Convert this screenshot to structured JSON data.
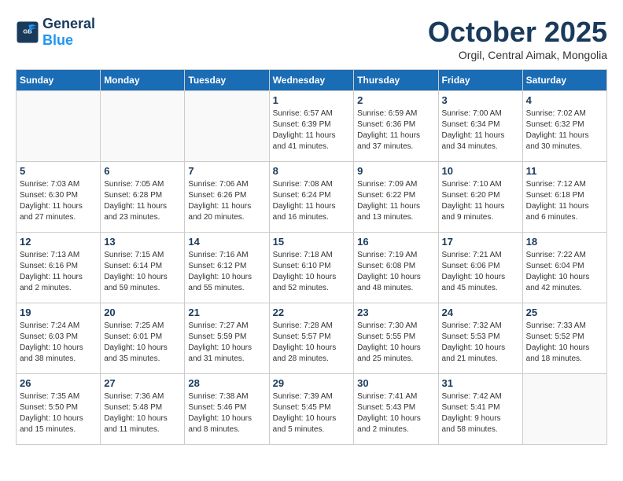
{
  "header": {
    "logo_general": "General",
    "logo_blue": "Blue",
    "month": "October 2025",
    "location": "Orgil, Central Aimak, Mongolia"
  },
  "days_of_week": [
    "Sunday",
    "Monday",
    "Tuesday",
    "Wednesday",
    "Thursday",
    "Friday",
    "Saturday"
  ],
  "weeks": [
    [
      {
        "day": "",
        "detail": ""
      },
      {
        "day": "",
        "detail": ""
      },
      {
        "day": "",
        "detail": ""
      },
      {
        "day": "1",
        "detail": "Sunrise: 6:57 AM\nSunset: 6:39 PM\nDaylight: 11 hours\nand 41 minutes."
      },
      {
        "day": "2",
        "detail": "Sunrise: 6:59 AM\nSunset: 6:36 PM\nDaylight: 11 hours\nand 37 minutes."
      },
      {
        "day": "3",
        "detail": "Sunrise: 7:00 AM\nSunset: 6:34 PM\nDaylight: 11 hours\nand 34 minutes."
      },
      {
        "day": "4",
        "detail": "Sunrise: 7:02 AM\nSunset: 6:32 PM\nDaylight: 11 hours\nand 30 minutes."
      }
    ],
    [
      {
        "day": "5",
        "detail": "Sunrise: 7:03 AM\nSunset: 6:30 PM\nDaylight: 11 hours\nand 27 minutes."
      },
      {
        "day": "6",
        "detail": "Sunrise: 7:05 AM\nSunset: 6:28 PM\nDaylight: 11 hours\nand 23 minutes."
      },
      {
        "day": "7",
        "detail": "Sunrise: 7:06 AM\nSunset: 6:26 PM\nDaylight: 11 hours\nand 20 minutes."
      },
      {
        "day": "8",
        "detail": "Sunrise: 7:08 AM\nSunset: 6:24 PM\nDaylight: 11 hours\nand 16 minutes."
      },
      {
        "day": "9",
        "detail": "Sunrise: 7:09 AM\nSunset: 6:22 PM\nDaylight: 11 hours\nand 13 minutes."
      },
      {
        "day": "10",
        "detail": "Sunrise: 7:10 AM\nSunset: 6:20 PM\nDaylight: 11 hours\nand 9 minutes."
      },
      {
        "day": "11",
        "detail": "Sunrise: 7:12 AM\nSunset: 6:18 PM\nDaylight: 11 hours\nand 6 minutes."
      }
    ],
    [
      {
        "day": "12",
        "detail": "Sunrise: 7:13 AM\nSunset: 6:16 PM\nDaylight: 11 hours\nand 2 minutes."
      },
      {
        "day": "13",
        "detail": "Sunrise: 7:15 AM\nSunset: 6:14 PM\nDaylight: 10 hours\nand 59 minutes."
      },
      {
        "day": "14",
        "detail": "Sunrise: 7:16 AM\nSunset: 6:12 PM\nDaylight: 10 hours\nand 55 minutes."
      },
      {
        "day": "15",
        "detail": "Sunrise: 7:18 AM\nSunset: 6:10 PM\nDaylight: 10 hours\nand 52 minutes."
      },
      {
        "day": "16",
        "detail": "Sunrise: 7:19 AM\nSunset: 6:08 PM\nDaylight: 10 hours\nand 48 minutes."
      },
      {
        "day": "17",
        "detail": "Sunrise: 7:21 AM\nSunset: 6:06 PM\nDaylight: 10 hours\nand 45 minutes."
      },
      {
        "day": "18",
        "detail": "Sunrise: 7:22 AM\nSunset: 6:04 PM\nDaylight: 10 hours\nand 42 minutes."
      }
    ],
    [
      {
        "day": "19",
        "detail": "Sunrise: 7:24 AM\nSunset: 6:03 PM\nDaylight: 10 hours\nand 38 minutes."
      },
      {
        "day": "20",
        "detail": "Sunrise: 7:25 AM\nSunset: 6:01 PM\nDaylight: 10 hours\nand 35 minutes."
      },
      {
        "day": "21",
        "detail": "Sunrise: 7:27 AM\nSunset: 5:59 PM\nDaylight: 10 hours\nand 31 minutes."
      },
      {
        "day": "22",
        "detail": "Sunrise: 7:28 AM\nSunset: 5:57 PM\nDaylight: 10 hours\nand 28 minutes."
      },
      {
        "day": "23",
        "detail": "Sunrise: 7:30 AM\nSunset: 5:55 PM\nDaylight: 10 hours\nand 25 minutes."
      },
      {
        "day": "24",
        "detail": "Sunrise: 7:32 AM\nSunset: 5:53 PM\nDaylight: 10 hours\nand 21 minutes."
      },
      {
        "day": "25",
        "detail": "Sunrise: 7:33 AM\nSunset: 5:52 PM\nDaylight: 10 hours\nand 18 minutes."
      }
    ],
    [
      {
        "day": "26",
        "detail": "Sunrise: 7:35 AM\nSunset: 5:50 PM\nDaylight: 10 hours\nand 15 minutes."
      },
      {
        "day": "27",
        "detail": "Sunrise: 7:36 AM\nSunset: 5:48 PM\nDaylight: 10 hours\nand 11 minutes."
      },
      {
        "day": "28",
        "detail": "Sunrise: 7:38 AM\nSunset: 5:46 PM\nDaylight: 10 hours\nand 8 minutes."
      },
      {
        "day": "29",
        "detail": "Sunrise: 7:39 AM\nSunset: 5:45 PM\nDaylight: 10 hours\nand 5 minutes."
      },
      {
        "day": "30",
        "detail": "Sunrise: 7:41 AM\nSunset: 5:43 PM\nDaylight: 10 hours\nand 2 minutes."
      },
      {
        "day": "31",
        "detail": "Sunrise: 7:42 AM\nSunset: 5:41 PM\nDaylight: 9 hours\nand 58 minutes."
      },
      {
        "day": "",
        "detail": ""
      }
    ]
  ]
}
